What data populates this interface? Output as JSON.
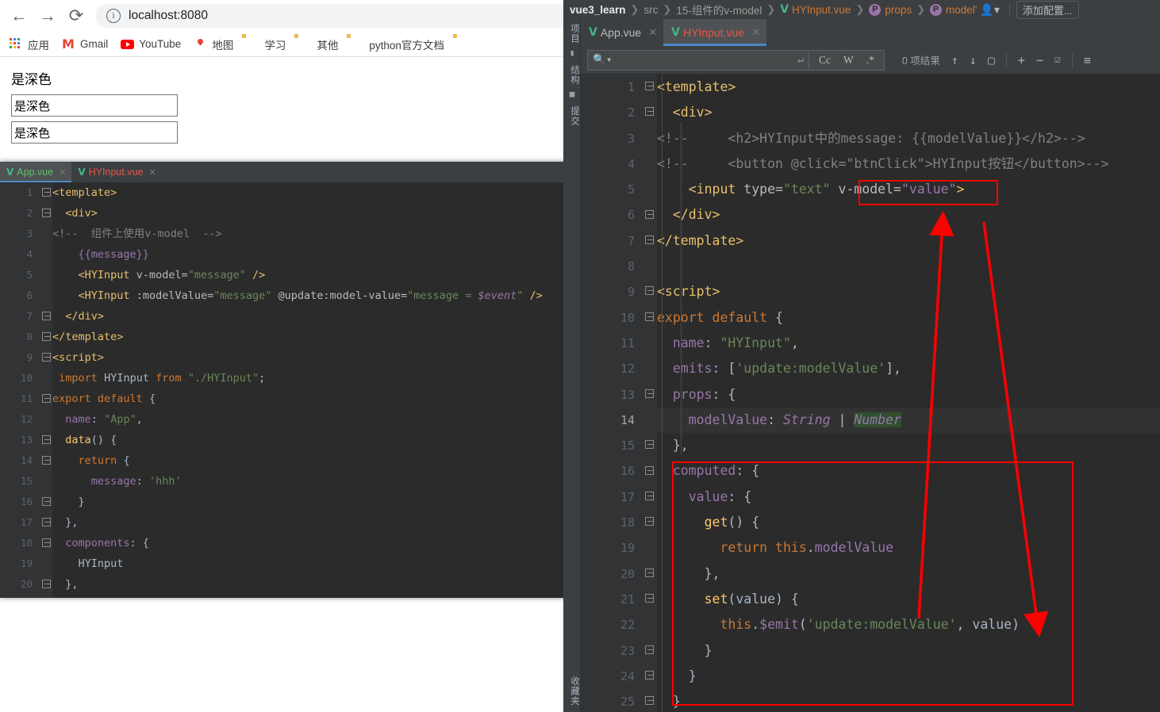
{
  "browser": {
    "nav": {
      "back": "←",
      "forward": "→",
      "reload": "⟳"
    },
    "omnibox": {
      "info_icon": "i",
      "url": "localhost:8080"
    },
    "bookmarks": [
      {
        "label": "应用",
        "icon": "apps-grid-icon"
      },
      {
        "label": "Gmail",
        "icon": "gmail-icon"
      },
      {
        "label": "YouTube",
        "icon": "youtube-icon"
      },
      {
        "label": "地图",
        "icon": "maps-icon"
      },
      {
        "label": "学习",
        "icon": "folder-icon"
      },
      {
        "label": "其他",
        "icon": "folder-icon"
      },
      {
        "label": "python官方文档",
        "icon": "folder-icon"
      },
      {
        "label": "",
        "icon": "folder-icon"
      }
    ],
    "page": {
      "heading": "是深色",
      "input1_value": "是深色",
      "input2_value": "是深色"
    }
  },
  "ide": {
    "breadcrumb": {
      "project": "vue3_learn",
      "items": [
        "src",
        "15-组件的v-model"
      ],
      "file": "HYInput.vue",
      "prop1": "props",
      "prop2": "model'",
      "badge": "P",
      "add_config": "添加配置..."
    },
    "tool_strip": {
      "top": [
        "项目",
        "结构",
        "提交"
      ],
      "bottom": [
        "收藏夹"
      ]
    },
    "tabs": [
      {
        "label": "App.vue",
        "active": false,
        "close": "✕"
      },
      {
        "label": "HYInput.vue",
        "active": true,
        "close": "✕"
      }
    ],
    "find_bar": {
      "placeholder": "",
      "match_case": "Cc",
      "words": "W",
      "regex": ".*",
      "results": "0 项结果",
      "prev": "↑",
      "next": "↓",
      "select_all": "▢",
      "add_occurrence": "+",
      "remove_occurrence": "−",
      "select_occurrences": "☑",
      "filter": "≡"
    },
    "editor": {
      "lines": [
        {
          "n": "1",
          "fold": "minus",
          "html": "<span class=\"t-tag\">&lt;template&gt;</span>"
        },
        {
          "n": "2",
          "fold": "minus",
          "html": "  <span class=\"t-tag\">&lt;div&gt;</span>"
        },
        {
          "n": "3",
          "fold": "",
          "html": "<span class=\"t-comment\">&lt;!--     &lt;h2&gt;HYInput中的message: {{modelValue}}&lt;/h2&gt;--&gt;</span>"
        },
        {
          "n": "4",
          "fold": "",
          "html": "<span class=\"t-comment\">&lt;!--     &lt;button @click=\"btnClick\"&gt;HYInput按钮&lt;/button&gt;--&gt;</span>"
        },
        {
          "n": "5",
          "fold": "",
          "html": "    <span class=\"t-tag\">&lt;input</span> <span class=\"t-attr\">type=</span><span class=\"t-str\">\"text\"</span> <span class=\"t-attr\">v-model=</span><span class=\"t-prop\">\"value\"</span><span class=\"t-tag\">&gt;</span>"
        },
        {
          "n": "6",
          "fold": "end",
          "html": "  <span class=\"t-tag\">&lt;/div&gt;</span>"
        },
        {
          "n": "7",
          "fold": "end",
          "html": "<span class=\"t-tag\">&lt;/template&gt;</span>"
        },
        {
          "n": "8",
          "fold": "",
          "html": ""
        },
        {
          "n": "9",
          "fold": "minus",
          "html": "<span class=\"t-tag\">&lt;script&gt;</span>"
        },
        {
          "n": "10",
          "fold": "minus",
          "html": "<span class=\"t-kw\">export default</span> <span class=\"t-plain\">{</span>"
        },
        {
          "n": "11",
          "fold": "",
          "html": "  <span class=\"t-prop\">name</span><span class=\"t-plain\">:</span> <span class=\"t-str\">\"HYInput\"</span><span class=\"t-plain\">,</span>"
        },
        {
          "n": "12",
          "fold": "",
          "html": "  <span class=\"t-prop\">emits</span><span class=\"t-plain\">:</span> <span class=\"t-plain\">[</span><span class=\"t-str\">'update:modelValue'</span><span class=\"t-plain\">],</span>"
        },
        {
          "n": "13",
          "fold": "minus",
          "html": "  <span class=\"t-prop\">props</span><span class=\"t-plain\">: {</span>"
        },
        {
          "n": "14",
          "fold": "",
          "hl": true,
          "html": "    <span class=\"t-prop\">modelValue</span><span class=\"t-plain\">:</span> <span class=\"t-prop t-italic\">String</span> <span class=\"t-plain\">|</span> <span class=\"t-prop t-italic t-hlbg\">Number</span>"
        },
        {
          "n": "15",
          "fold": "end",
          "html": "  <span class=\"t-plain\">},</span>"
        },
        {
          "n": "16",
          "fold": "minus",
          "html": "  <span class=\"t-prop\">computed</span><span class=\"t-plain\">: {</span>"
        },
        {
          "n": "17",
          "fold": "minus",
          "html": "    <span class=\"t-prop\">value</span><span class=\"t-plain\">: {</span>"
        },
        {
          "n": "18",
          "fold": "minus",
          "html": "      <span class=\"t-fn\">get</span><span class=\"t-plain\">() {</span>"
        },
        {
          "n": "19",
          "fold": "",
          "html": "        <span class=\"t-kw\">return</span> <span class=\"t-kw\">this</span><span class=\"t-plain\">.</span><span class=\"t-prop\">modelValue</span>"
        },
        {
          "n": "20",
          "fold": "end",
          "html": "      <span class=\"t-plain\">},</span>"
        },
        {
          "n": "21",
          "fold": "minus",
          "html": "      <span class=\"t-fn\">set</span><span class=\"t-plain\">(value) {</span>"
        },
        {
          "n": "22",
          "fold": "",
          "html": "        <span class=\"t-kw\">this</span><span class=\"t-plain\">.</span><span class=\"t-prop\">$emit</span><span class=\"t-plain\">(</span><span class=\"t-str\">'update:modelValue'</span><span class=\"t-plain\">, value)</span>"
        },
        {
          "n": "23",
          "fold": "end",
          "html": "      <span class=\"t-plain\">}</span>"
        },
        {
          "n": "24",
          "fold": "end",
          "html": "    <span class=\"t-plain\">}</span>"
        },
        {
          "n": "25",
          "fold": "end",
          "html": "  <span class=\"t-plain\">}</span>"
        }
      ]
    }
  },
  "mini_ide": {
    "tabs": [
      {
        "label": "App.vue",
        "active": true,
        "close": "✕",
        "color": "green"
      },
      {
        "label": "HYInput.vue",
        "active": false,
        "close": "✕",
        "color": "red"
      }
    ],
    "lines": [
      {
        "n": "1",
        "fold": "minus",
        "html": "<span class=\"t-tag\">&lt;template&gt;</span>"
      },
      {
        "n": "2",
        "fold": "minus",
        "html": "  <span class=\"t-tag\">&lt;div&gt;</span>"
      },
      {
        "n": "3",
        "fold": "",
        "html": "<span class=\"t-comment\">&lt;!--  组件上使用v-model  --&gt;</span>"
      },
      {
        "n": "4",
        "fold": "",
        "html": "    <span class=\"t-prop\">{{message}}</span>"
      },
      {
        "n": "5",
        "fold": "",
        "html": "    <span class=\"t-tag\">&lt;HYInput</span> <span class=\"t-attr\">v-model=</span><span class=\"t-str\">\"message\"</span> <span class=\"t-tag\">/&gt;</span>"
      },
      {
        "n": "6",
        "fold": "",
        "html": "    <span class=\"t-tag\">&lt;HYInput</span> <span class=\"t-attr\">:modelValue=</span><span class=\"t-str\">\"message\"</span> <span class=\"t-attr\">@update:model-value=</span><span class=\"t-str\">\"message = </span><span class=\"t-prop t-italic\">$event</span><span class=\"t-str\">\"</span> <span class=\"t-tag\">/&gt;</span>"
      },
      {
        "n": "7",
        "fold": "end",
        "html": "  <span class=\"t-tag\">&lt;/div&gt;</span>"
      },
      {
        "n": "8",
        "fold": "end",
        "html": "<span class=\"t-tag\">&lt;/template&gt;</span>"
      },
      {
        "n": "9",
        "fold": "minus",
        "html": "<span class=\"t-tag\">&lt;script&gt;</span>"
      },
      {
        "n": "10",
        "fold": "",
        "html": " <span class=\"t-kw\">import</span> <span class=\"t-plain\">HYInput</span> <span class=\"t-kw\">from</span> <span class=\"t-str\">\"./HYInput\"</span><span class=\"t-plain\">;</span>"
      },
      {
        "n": "11",
        "fold": "minus",
        "html": "<span class=\"t-kw\">export default</span> <span class=\"t-plain\">{</span>"
      },
      {
        "n": "12",
        "fold": "",
        "html": "  <span class=\"t-prop\">name</span><span class=\"t-plain\">:</span> <span class=\"t-str\">\"App\"</span><span class=\"t-plain\">,</span>"
      },
      {
        "n": "13",
        "fold": "minus",
        "html": "  <span class=\"t-fn\">data</span><span class=\"t-plain\">() {</span>"
      },
      {
        "n": "14",
        "fold": "minus",
        "html": "    <span class=\"t-kw\">return</span> <span class=\"t-plain\">{</span>"
      },
      {
        "n": "15",
        "fold": "",
        "html": "      <span class=\"t-prop\">message</span><span class=\"t-plain\">:</span> <span class=\"t-str\">'hhh'</span>"
      },
      {
        "n": "16",
        "fold": "end",
        "html": "    <span class=\"t-plain\">}</span>"
      },
      {
        "n": "17",
        "fold": "end",
        "html": "  <span class=\"t-plain\">},</span>"
      },
      {
        "n": "18",
        "fold": "minus",
        "html": "  <span class=\"t-prop\">components</span><span class=\"t-plain\">: {</span>"
      },
      {
        "n": "19",
        "fold": "",
        "html": "    <span class=\"t-plain\">HYInput</span>"
      },
      {
        "n": "20",
        "fold": "end",
        "html": "  <span class=\"t-plain\">},</span>"
      }
    ]
  },
  "annotations": {
    "color": "#ff0000",
    "boxes": [
      {
        "name": "v-model-highlight-box"
      },
      {
        "name": "computed-block-box"
      }
    ],
    "arrows": [
      {
        "name": "arrow-modelvalue-to-vmodel"
      },
      {
        "name": "arrow-vmodel-to-value"
      }
    ]
  }
}
